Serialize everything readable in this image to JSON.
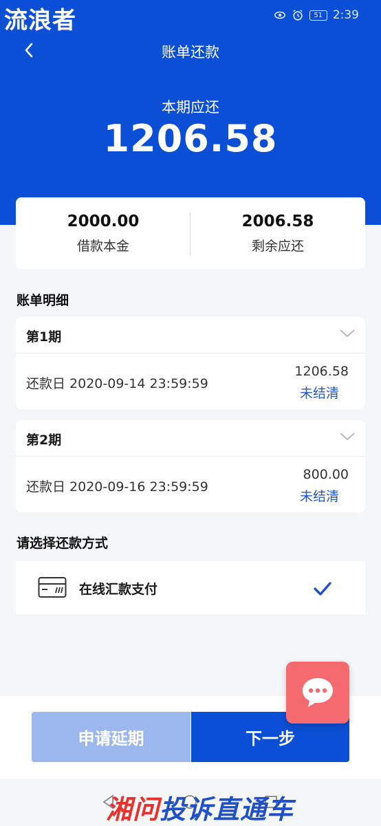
{
  "watermark": "流浪者",
  "status": {
    "battery": "51",
    "time": "2:39"
  },
  "header": {
    "title": "账单还款"
  },
  "due": {
    "label": "本期应还",
    "amount": "1206.58"
  },
  "summary": [
    {
      "value": "2000.00",
      "label": "借款本金"
    },
    {
      "value": "2006.58",
      "label": "剩余应还"
    }
  ],
  "details": {
    "title": "账单明细",
    "periods": [
      {
        "name": "第1期",
        "date": "还款日 2020-09-14 23:59:59",
        "amount": "1206.58",
        "status": "未结清"
      },
      {
        "name": "第2期",
        "date": "还款日 2020-09-16 23:59:59",
        "amount": "800.00",
        "status": "未结清"
      }
    ]
  },
  "payment": {
    "title": "请选择还款方式",
    "method": "在线汇款支付"
  },
  "buttons": {
    "extend": "申请延期",
    "next": "下一步"
  },
  "footer_watermark": {
    "part1": "湘问",
    "part2": "投诉直通车"
  },
  "colors": {
    "primary": "#0b4fd6",
    "disabled": "#9cb6ee",
    "fab": "#f46a6f",
    "status_text": "#1f57c9"
  }
}
